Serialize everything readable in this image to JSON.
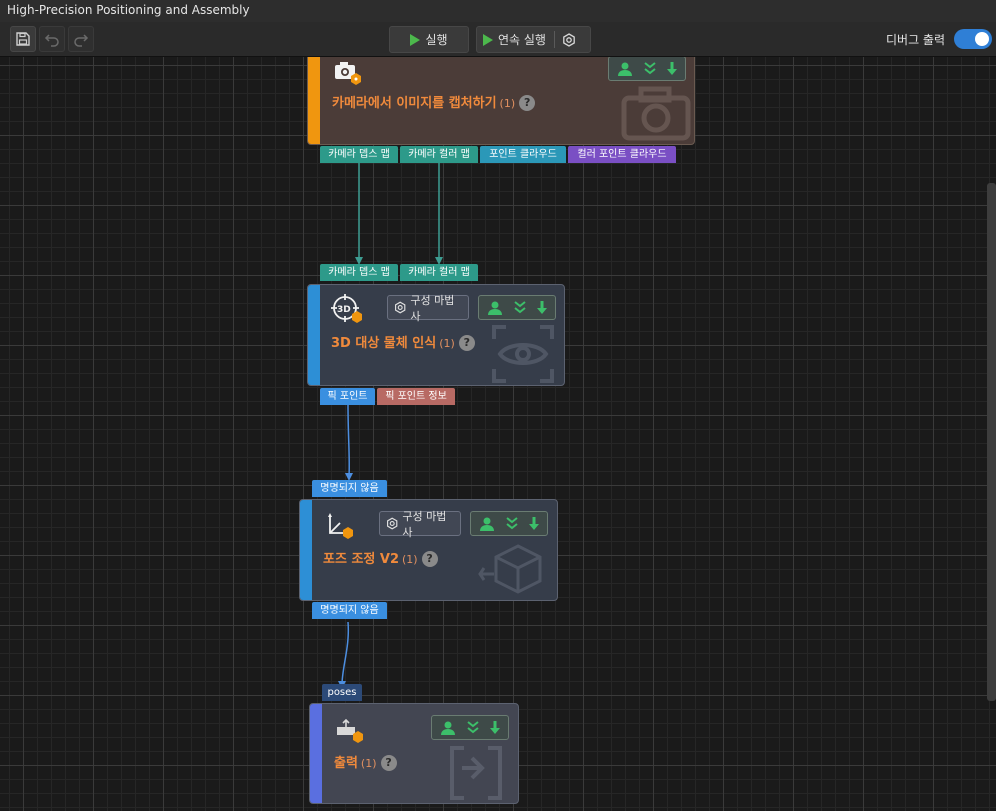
{
  "window": {
    "title": "High-Precision Positioning and Assembly"
  },
  "toolbar": {
    "run_label": "실행",
    "continuous_run_label": "연속 실행",
    "debug_output_label": "디버그 출력",
    "debug_output_enabled": true
  },
  "colors": {
    "accent_blue": "#2f7fd6",
    "run_green": "#4cb84c",
    "node_title": "#f08a3c"
  },
  "nodes": {
    "capture": {
      "title": "카메라에서 이미지를 캡처하기",
      "count": "(1)",
      "help": "?",
      "bar_color": "#f0960f",
      "outputs": [
        "카메라 뎁스 맵",
        "카메라 컬러 맵",
        "포인트 클라우드",
        "컬러 포인트 클라우드"
      ]
    },
    "recognition": {
      "title": "3D 대상 물체 인식",
      "count": "(1)",
      "help": "?",
      "wizard_label": "구성 마법사",
      "bar_color": "#2d8fd6",
      "inputs": [
        "카메라 뎁스 맵",
        "카메라 컬러 맵"
      ],
      "outputs": [
        "픽 포인트",
        "픽 포인트 정보"
      ]
    },
    "pose_adjust": {
      "title": "포즈 조정 V2",
      "count": "(1)",
      "help": "?",
      "wizard_label": "구성 마법사",
      "bar_color": "#2d8fd6",
      "input": "명명되지 않음",
      "output": "명명되지 않음"
    },
    "output": {
      "title": "출력",
      "count": "(1)",
      "help": "?",
      "bar_color": "#5a6fe0",
      "input": "poses"
    }
  }
}
